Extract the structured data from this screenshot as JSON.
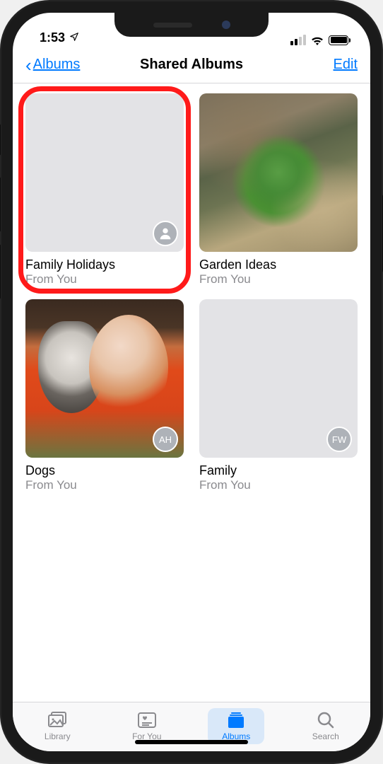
{
  "status": {
    "time": "1:53"
  },
  "nav": {
    "back_label": "Albums",
    "title": "Shared Albums",
    "edit_label": "Edit"
  },
  "albums": [
    {
      "title": "Family Holidays",
      "subtitle": "From You",
      "thumb": "empty",
      "badge_type": "person",
      "badge_text": "",
      "highlighted": true
    },
    {
      "title": "Garden Ideas",
      "subtitle": "From You",
      "thumb": "garden",
      "badge_type": "none",
      "badge_text": "",
      "highlighted": false
    },
    {
      "title": "Dogs",
      "subtitle": "From You",
      "thumb": "dogs",
      "badge_type": "initials",
      "badge_text": "AH",
      "highlighted": false
    },
    {
      "title": "Family",
      "subtitle": "From You",
      "thumb": "empty",
      "badge_type": "initials",
      "badge_text": "FW",
      "highlighted": false
    }
  ],
  "tabs": {
    "library": "Library",
    "foryou": "For You",
    "albums": "Albums",
    "search": "Search"
  }
}
